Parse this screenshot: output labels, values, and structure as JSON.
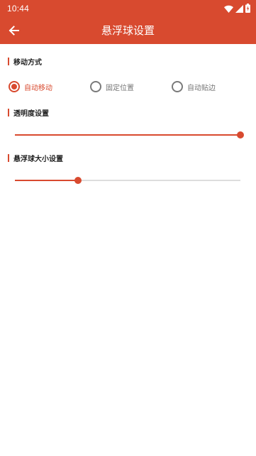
{
  "status_bar": {
    "time": "10:44",
    "icons": [
      "wifi-icon",
      "cellular-signal-icon",
      "battery-charging-icon"
    ]
  },
  "toolbar": {
    "title": "悬浮球设置",
    "back_icon": "arrow-left-icon"
  },
  "sections": {
    "move_mode": {
      "title": "移动方式",
      "options": [
        {
          "label": "自动移动",
          "checked": true
        },
        {
          "label": "固定位置",
          "checked": false
        },
        {
          "label": "自动贴边",
          "checked": false
        }
      ]
    },
    "transparency": {
      "title": "透明度设置",
      "level": 1.0
    },
    "size": {
      "title": "悬浮球大小设置",
      "level": 0.28
    }
  },
  "colors": {
    "accent": "#d84a2f",
    "track": "#dddddd",
    "radio_unchecked": "#7a7a7a"
  }
}
